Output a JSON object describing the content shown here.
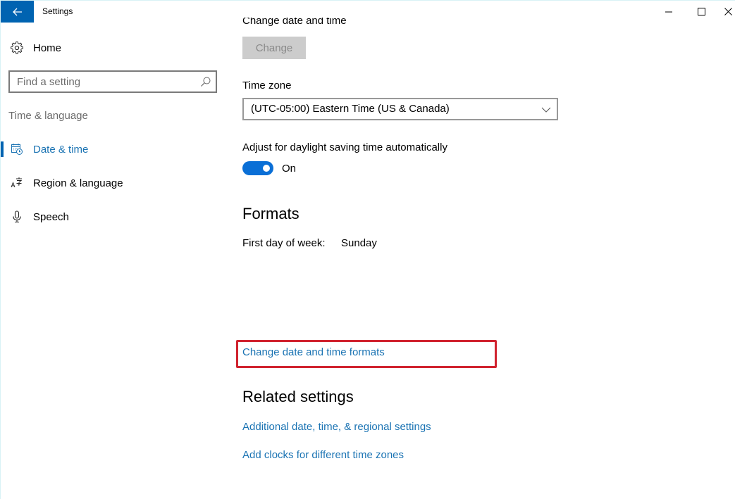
{
  "window": {
    "title": "Settings",
    "controls": {
      "minimize": "minimize-icon",
      "maximize": "maximize-icon",
      "close": "close-icon"
    },
    "back_icon": "back-arrow-icon"
  },
  "colors": {
    "accent": "#0063b1",
    "link": "#1a73b3",
    "toggle_on": "#0a6fd6",
    "highlight_box": "#d0232f",
    "disabled_button_bg": "#cccccc"
  },
  "sidebar": {
    "home": {
      "label": "Home",
      "icon": "gear-icon"
    },
    "search": {
      "placeholder": "Find a setting",
      "value": "",
      "icon": "search-icon"
    },
    "section_label": "Time & language",
    "items": [
      {
        "label": "Date & time",
        "icon": "calendar-clock-icon",
        "active": true
      },
      {
        "label": "Region & language",
        "icon": "language-icon",
        "active": false
      },
      {
        "label": "Speech",
        "icon": "microphone-icon",
        "active": false
      }
    ]
  },
  "main": {
    "change_date_time": {
      "title": "Change date and time",
      "button_label": "Change",
      "button_disabled": true
    },
    "time_zone": {
      "label": "Time zone",
      "selected": "(UTC-05:00) Eastern Time (US & Canada)"
    },
    "daylight_saving": {
      "label": "Adjust for daylight saving time automatically",
      "state": "On",
      "enabled": true
    },
    "formats": {
      "heading": "Formats",
      "first_day_label": "First day of week:",
      "first_day_value": "Sunday",
      "change_formats_link": "Change date and time formats"
    },
    "related_settings": {
      "heading": "Related settings",
      "links": [
        "Additional date, time, & regional settings",
        "Add clocks for different time zones"
      ]
    }
  }
}
